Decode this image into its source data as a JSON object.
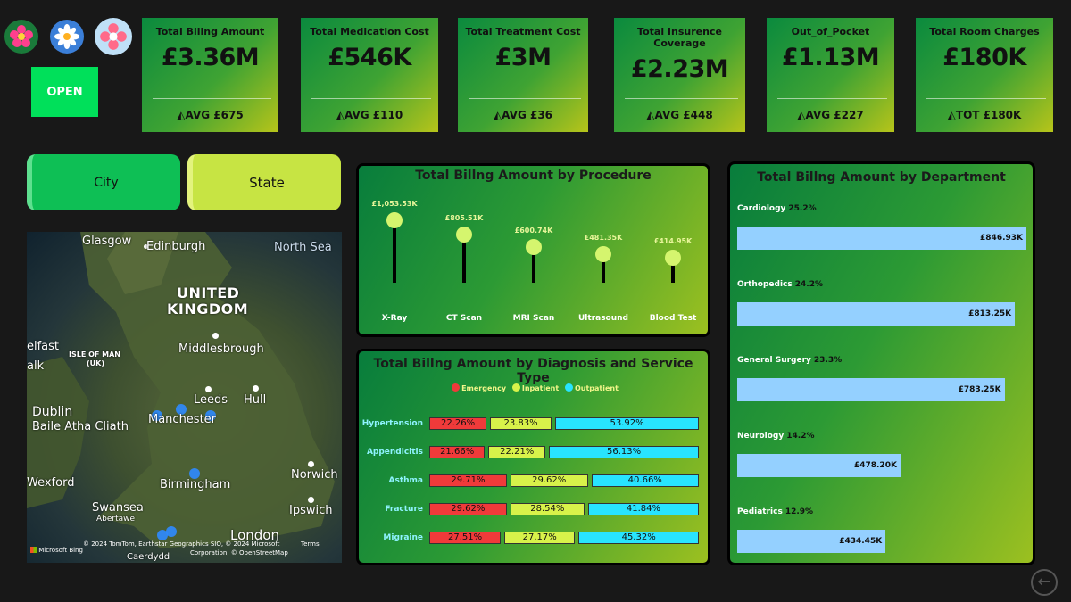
{
  "open_button": "OPEN",
  "kpis": [
    {
      "title": "Total Billng Amount",
      "value": "£3.36M",
      "sub": "◭AVG £675"
    },
    {
      "title": "Total Medication Cost",
      "value": "£546K",
      "sub": "◭AVG £110"
    },
    {
      "title": "Total Treatment Cost",
      "value": "£3M",
      "sub": "◭AVG £36"
    },
    {
      "title": "Total Insurence Coverage",
      "value": "£2.23M",
      "sub": "◭AVG £448"
    },
    {
      "title": "Out_of_Pocket",
      "value": "£1.13M",
      "sub": "◭AVG £227"
    },
    {
      "title": "Total Room Charges",
      "value": "£180K",
      "sub": "◭TOT £180K"
    }
  ],
  "slicers": {
    "city": "City",
    "state": "State"
  },
  "map": {
    "labels": {
      "glasgow": "Glasgow",
      "edinburgh": "Edinburgh",
      "north_sea": "North Sea",
      "uk1": "UNITED",
      "uk2": "KINGDOM",
      "belfast": "elfast",
      "isle": "ISLE OF MAN",
      "isle_uk": "(UK)",
      "alk": "alk",
      "middlesbrough": "Middlesbrough",
      "leeds": "Leeds",
      "hull": "Hull",
      "dublin": "Dublin",
      "baile": "Baile Atha Cliath",
      "manchester": "Manchester",
      "norwich": "Norwich",
      "wexford": "Wexford",
      "birmingham": "Birmingham",
      "swansea": "Swansea",
      "abertawe": "Abertawe",
      "ipswich": "Ipswich",
      "london": "London",
      "cardiff": "Caerdydd"
    },
    "attribution1": "© 2024 TomTom, Earthstar Geographics SIO, © 2024 Microsoft",
    "attribution_terms": "Terms",
    "attribution2": "Corporation, © OpenStreetMap",
    "bing": "Microsoft Bing"
  },
  "procedure_panel": {
    "title": "Total Billng Amount by Procedure"
  },
  "diagnosis_panel": {
    "title": "Total Billng Amount by Diagnosis and Service Type",
    "legend": [
      "Emergency",
      "Inpatient",
      "Outpatient"
    ]
  },
  "department_panel": {
    "title": "Total Billng Amount by Department"
  },
  "colors": {
    "emergency": "#f03a3a",
    "inpatient": "#d8f24a",
    "outpatient": "#28e4ff",
    "dept_bar": "#94d0ff"
  },
  "chart_data": [
    {
      "type": "bar",
      "title": "Total Billng Amount by Procedure",
      "categories": [
        "X-Ray",
        "CT Scan",
        "MRI Scan",
        "Ultrasound",
        "Blood Test"
      ],
      "values": [
        1053.53,
        805.51,
        600.74,
        481.35,
        414.95
      ],
      "labels": [
        "£1,053.53K",
        "£805.51K",
        "£600.74K",
        "£481.35K",
        "£414.95K"
      ]
    },
    {
      "type": "bar",
      "title": "Total Billng Amount by Diagnosis and Service Type",
      "categories": [
        "Hypertension",
        "Appendicitis",
        "Asthma",
        "Fracture",
        "Migraine"
      ],
      "series": [
        {
          "name": "Emergency",
          "values": [
            22.26,
            21.66,
            29.71,
            29.62,
            27.51
          ]
        },
        {
          "name": "Inpatient",
          "values": [
            23.83,
            22.21,
            29.62,
            28.54,
            27.17
          ]
        },
        {
          "name": "Outpatient",
          "values": [
            53.92,
            56.13,
            40.66,
            41.84,
            45.32
          ]
        }
      ]
    },
    {
      "type": "bar",
      "title": "Total Billng Amount by Department",
      "categories": [
        "Cardiology",
        "Orthopedics",
        "General Surgery",
        "Neurology",
        "Pediatrics"
      ],
      "values": [
        846.93,
        813.25,
        783.25,
        478.2,
        434.45
      ],
      "labels": [
        "£846.93K",
        "£813.25K",
        "£783.25K",
        "£478.20K",
        "£434.45K"
      ],
      "percents": [
        "25.2%",
        "24.2%",
        "23.3%",
        "14.2%",
        "12.9%"
      ]
    }
  ]
}
